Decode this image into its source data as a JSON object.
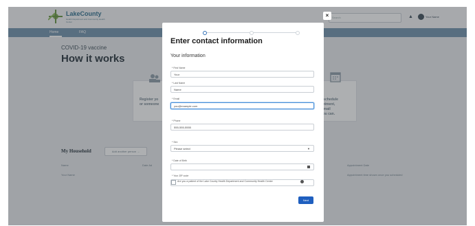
{
  "header": {
    "brand": "LakeCounty",
    "brand_sub": "Health Department and Community Health Center",
    "search_placeholder": "Search",
    "user_name": "Your Name"
  },
  "nav": {
    "items": [
      "Home",
      "FAQ"
    ]
  },
  "page": {
    "covid_label": "COVID-19 vaccine",
    "title": "How it works",
    "card_left_text": "Register yo\nor someone",
    "card_right_text": "...ule, schedule\nappointment,\nwe'll email\nfirst you can."
  },
  "household": {
    "title": "My Household",
    "add_button": "Add another person →",
    "col_name": "Name",
    "col_date": "Date Ad",
    "col_appt": "Appointment Date",
    "row_name": "Your Name",
    "row_appt": "Appointment time shown once you scheduled"
  },
  "modal": {
    "close_label": "×",
    "title": "Enter contact information",
    "subtitle": "Your information",
    "fields": {
      "first_name_label": "* First Name",
      "first_name_value": "Your",
      "last_name_label": "* Last Name",
      "last_name_value": "Name",
      "email_label": "* Email",
      "email_value": "you@example.com",
      "phone_label": "* Phone",
      "phone_value": "555-555-5555",
      "sex_label": "* Sex",
      "sex_value": "Please select",
      "dob_label": "* Date of Birth",
      "dob_value": "",
      "zip_label": "* Your ZIP code",
      "zip_value": ""
    },
    "checkbox_label": "Are you a patient of the Lake County Health Department and Community Health Center",
    "next_label": "Next",
    "progress_step": 1,
    "progress_total": 3
  },
  "colors": {
    "accent": "#1f5fbf",
    "nav": "#6d8fab",
    "overlay": "#3c4046"
  }
}
